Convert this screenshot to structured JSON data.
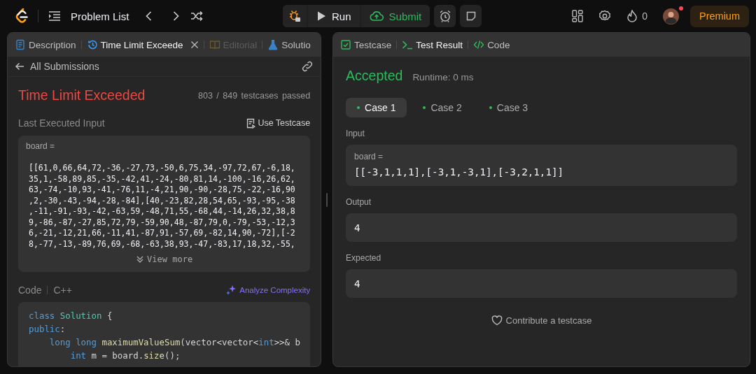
{
  "topbar": {
    "problem_list": "Problem List",
    "run": "Run",
    "submit": "Submit",
    "streak": "0",
    "premium": "Premium",
    "notification": true
  },
  "left_panel": {
    "tabs": [
      {
        "label": "Description",
        "selected": false,
        "disabled": false,
        "closable": false
      },
      {
        "label": "Time Limit Exceede",
        "selected": true,
        "disabled": false,
        "closable": true
      },
      {
        "label": "Editorial",
        "selected": false,
        "disabled": true,
        "closable": false
      },
      {
        "label": "Solutio",
        "selected": false,
        "disabled": false,
        "closable": false
      }
    ],
    "back_link": "All Submissions",
    "status": "Time Limit Exceeded",
    "passed": "803 / 849",
    "passed_label": "testcases passed",
    "input_heading": "Last Executed Input",
    "use_testcase": "Use Testcase",
    "input_var": "board =",
    "input_lines": [
      "[[61,0,66,64,72,-36,-27,73,-50,6,75,34,-97,72,67,-6,18,",
      "35,1,-58,89,85,-35,-42,41,-24,-80,81,14,-100,-16,26,62,",
      "63,-74,-10,93,-41,-76,11,-4,21,90,-90,-28,75,-22,-16,90",
      ",2,-30,-43,-94,-28,-84],[40,-23,82,28,54,65,-93,-95,-38",
      ",-11,-91,-93,-42,-63,59,-48,71,55,-68,44,-14,26,32,38,8",
      "9,-86,-87,-27,85,72,79,-59,90,48,-87,79,0,-79,-53,-12,3",
      "6,-21,-12,21,66,-11,41,-87,91,-57,69,-82,14,90,-72],[-2",
      "8,-77,-13,-89,76,69,-68,-63,38,93,-47,-83,17,18,32,-55,"
    ],
    "view_more": "View more",
    "code_heading": "Code",
    "language": "C++",
    "analyze": "Analyze Complexity",
    "code_lines": [
      [
        {
          "text": "class",
          "kind": "keyword"
        },
        {
          "text": " Solution",
          "kind": "type"
        },
        {
          "text": " {",
          "kind": "plain"
        }
      ],
      [
        {
          "text": "public",
          "kind": "keyword"
        },
        {
          "text": ":",
          "kind": "plain"
        }
      ],
      [
        {
          "text": "    long long",
          "kind": "keyword"
        },
        {
          "text": " maximumValueSum",
          "kind": "function"
        },
        {
          "text": "(vector<vector<",
          "kind": "plain"
        },
        {
          "text": "int",
          "kind": "keyword"
        },
        {
          "text": ">>& b",
          "kind": "plain"
        }
      ],
      [
        {
          "text": "        int",
          "kind": "keyword"
        },
        {
          "text": " m = board.",
          "kind": "plain"
        },
        {
          "text": "size",
          "kind": "function"
        },
        {
          "text": "();",
          "kind": "plain"
        }
      ]
    ]
  },
  "right_panel": {
    "tabs": [
      {
        "label": "Testcase",
        "selected": false
      },
      {
        "label": "Test Result",
        "selected": true
      },
      {
        "label": "Code",
        "selected": false
      }
    ],
    "verdict": "Accepted",
    "runtime": "Runtime: 0 ms",
    "cases": [
      {
        "label": "Case 1",
        "selected": true,
        "color": "#2cbb5d"
      },
      {
        "label": "Case 2",
        "selected": false,
        "color": "#2cbb5d"
      },
      {
        "label": "Case 3",
        "selected": false,
        "color": "#2cbb5d"
      }
    ],
    "input_label": "Input",
    "input_var": "board =",
    "input_value": "[[-3,1,1,1],[-3,1,-3,1],[-3,2,1,1]]",
    "output_label": "Output",
    "output_value": "4",
    "expected_label": "Expected",
    "expected_value": "4",
    "contribute": "Contribute a testcase"
  }
}
